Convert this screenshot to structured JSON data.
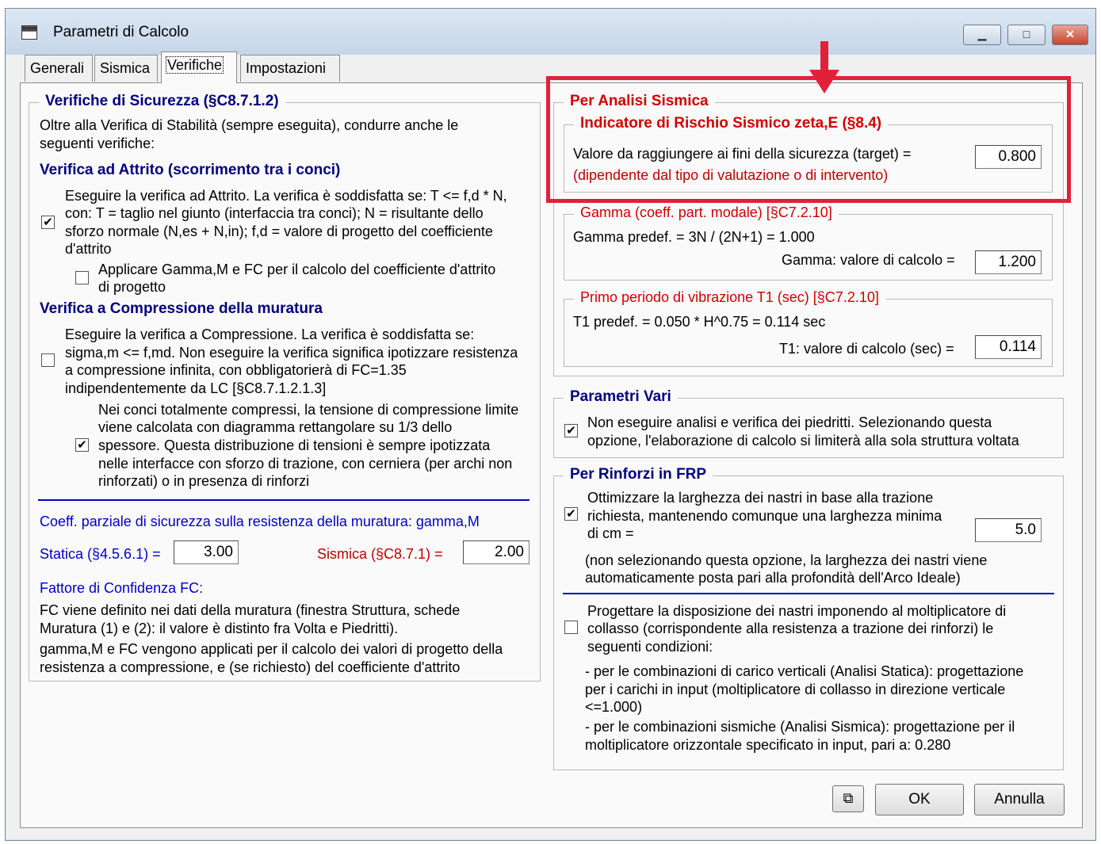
{
  "window": {
    "title": "Parametri di Calcolo",
    "controls": {
      "minimize": "▁",
      "maximize": "□",
      "close": "✕"
    }
  },
  "tabs": [
    {
      "label": "Generali"
    },
    {
      "label": "Sismica"
    },
    {
      "label": "Verifiche",
      "active": true
    },
    {
      "label": "Impostazioni"
    }
  ],
  "left": {
    "group_title": "Verifiche di Sicurezza (§C8.7.1.2)",
    "intro": [
      "Oltre alla Verifica di Stabilità (sempre eseguita), condurre anche le",
      "seguenti verifiche:"
    ],
    "attrito": {
      "heading": "Verifica ad Attrito (scorrimento tra i conci)",
      "checked": true,
      "text": [
        "Eseguire la verifica ad Attrito. La verifica è soddisfatta se: T <= f,d * N,",
        "con: T = taglio nel giunto (interfaccia tra conci); N = risultante dello",
        "sforzo normale (N,es + N,in); f,d = valore di progetto del coefficiente",
        "d'attrito"
      ],
      "sub_checked": false,
      "sub_text": [
        "Applicare Gamma,M e FC per il calcolo del coefficiente d'attrito",
        "di progetto"
      ]
    },
    "compressione": {
      "heading": "Verifica a Compressione della muratura",
      "checked": false,
      "text": [
        "Eseguire la verifica a Compressione. La verifica è soddisfatta se:",
        "sigma,m <= f,md. Non eseguire la verifica significa ipotizzare resistenza",
        "a compressione infinita, con obbligatorierà di FC=1.35",
        "indipendentemente da LC [§C8.7.1.2.1.3]"
      ],
      "sub_checked": true,
      "sub_text": [
        "Nei conci totalmente compressi, la tensione di compressione limite",
        "viene calcolata con diagramma rettangolare su 1/3 dello",
        "spessore. Questa distribuzione di tensioni è sempre ipotizzata",
        "nelle interfacce con sforzo di trazione, con cerniera (per archi non",
        "rinforzati) o in presenza di rinforzi"
      ]
    },
    "coeff": {
      "label": "Coeff. parziale di sicurezza sulla resistenza della muratura: gamma,M",
      "statica_label": "Statica (§4.5.6.1) =",
      "statica_value": "3.00",
      "sismica_label": "Sismica (§C8.7.1) =",
      "sismica_value": "2.00"
    },
    "fc": {
      "label": "Fattore di Confidenza FC:",
      "text": [
        "FC viene definito nei dati della muratura (finestra Struttura, schede",
        "Muratura (1) e (2): il valore è distinto fra Volta e Piedritti).",
        "gamma,M e FC vengono applicati per il calcolo dei valori di progetto della",
        "resistenza a compressione, e (se richiesto) del coefficiente d'attrito"
      ]
    }
  },
  "right": {
    "sismica": {
      "title": "Per Analisi Sismica",
      "zeta": {
        "title": "Indicatore di Rischio Sismico zeta,E (§8.4)",
        "label": "Valore da raggiungere ai fini della sicurezza (target) =",
        "note": "(dipendente dal tipo di valutazione o di intervento)",
        "value": "0.800"
      },
      "gamma": {
        "title": "Gamma (coeff. part. modale) [§C7.2.10]",
        "predef": "Gamma predef. = 3N / (2N+1) = 1.000",
        "calc_label": "Gamma: valore di calcolo =",
        "value": "1.200"
      },
      "t1": {
        "title": "Primo periodo di vibrazione T1 (sec) [§C7.2.10]",
        "predef": "T1 predef. = 0.050 * H^0.75 = 0.114 sec",
        "calc_label": "T1: valore di calcolo (sec) =",
        "value": "0.114"
      }
    },
    "vari": {
      "title": "Parametri Vari",
      "checked": true,
      "text": [
        "Non eseguire analisi e verifica dei piedritti. Selezionando questa",
        "opzione, l'elaborazione di calcolo si limiterà alla sola struttura voltata"
      ]
    },
    "frp": {
      "title": "Per Rinforzi in FRP",
      "opt1_checked": true,
      "opt1_text": [
        "Ottimizzare la larghezza dei nastri in base alla trazione",
        "richiesta, mantenendo comunque una larghezza minima",
        "di cm ="
      ],
      "width_value": "5.0",
      "note": [
        "(non selezionando questa opzione, la larghezza dei nastri viene",
        "automaticamente posta pari alla profondità dell'Arco Ideale)"
      ],
      "opt2_checked": false,
      "opt2_text": [
        "Progettare la disposizione dei nastri imponendo al moltiplicatore di",
        "collasso (corrispondente alla resistenza a trazione dei rinforzi) le",
        "seguenti condizioni:"
      ],
      "cond1": [
        "- per le combinazioni di carico verticali (Analisi Statica): progettazione",
        "per i carichi in input (moltiplicatore di collasso in direzione verticale",
        "<=1.000)"
      ],
      "cond2": [
        "- per le combinazioni sismiche (Analisi Sismica): progettazione per il",
        "moltiplicatore orizzontale specificato in input, pari a: 0.280"
      ]
    }
  },
  "buttons": {
    "ok": "OK",
    "cancel": "Annulla",
    "copy_icon": "copy-icon"
  },
  "colors": {
    "accent_blue": "#0000c8",
    "title_navy": "#000080",
    "highlight_red": "#e3203a"
  }
}
